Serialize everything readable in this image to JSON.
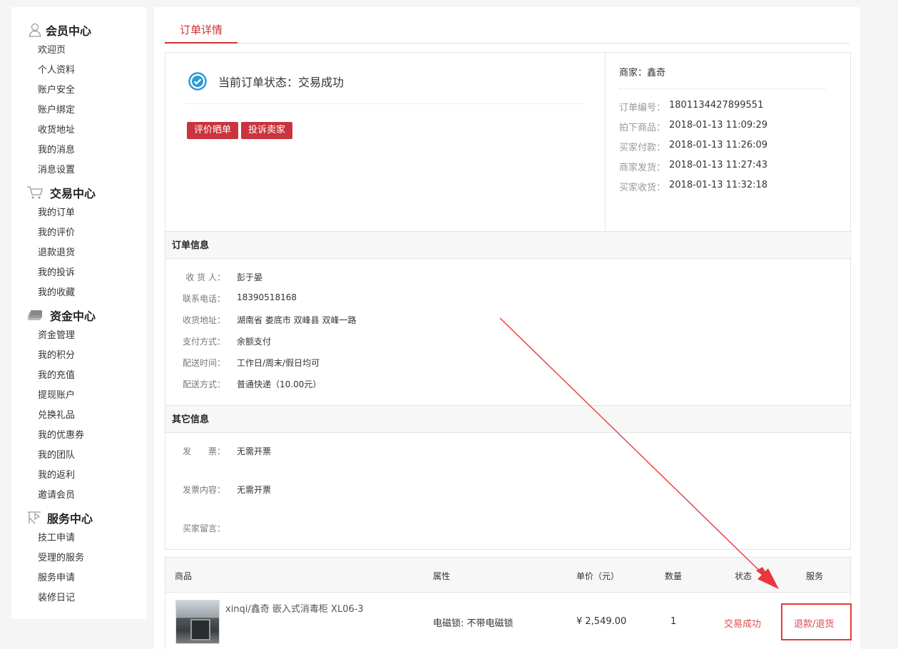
{
  "sidebar": {
    "groups": [
      {
        "title": "会员中心",
        "icon": "user-icon",
        "items": [
          "欢迎页",
          "个人资料",
          "账户安全",
          "账户绑定",
          "收货地址",
          "我的消息",
          "消息设置"
        ]
      },
      {
        "title": "交易中心",
        "icon": "cart-icon",
        "items": [
          "我的订单",
          "我的评价",
          "退款退货",
          "我的投诉",
          "我的收藏"
        ]
      },
      {
        "title": "资金中心",
        "icon": "money-icon",
        "items": [
          "资金管理",
          "我的积分",
          "我的充值",
          "提现账户",
          "兑换礼品",
          "我的优惠券",
          "我的团队",
          "我的返利",
          "邀请会员"
        ]
      },
      {
        "title": "服务中心",
        "icon": "service-icon",
        "items": [
          "技工申请",
          "受理的服务",
          "服务申请",
          "装修日记"
        ]
      }
    ]
  },
  "tab": {
    "label": "订单详情"
  },
  "status": {
    "text": "当前订单状态：交易成功",
    "buttons": [
      "评价晒单",
      "投诉卖家"
    ],
    "merchant": "商家：鑫奇",
    "details": [
      {
        "k": "订单编号：",
        "v": "1801134427899551"
      },
      {
        "k": "拍下商品：",
        "v": "2018-01-13 11:09:29"
      },
      {
        "k": "买家付款：",
        "v": "2018-01-13 11:26:09"
      },
      {
        "k": "商家发货：",
        "v": "2018-01-13 11:27:43"
      },
      {
        "k": "买家收货：",
        "v": "2018-01-13 11:32:18"
      }
    ]
  },
  "order_info": {
    "title": "订单信息",
    "rows": [
      {
        "k": "收 货 人：",
        "v": "彭于晏"
      },
      {
        "k": "联系电话：",
        "v": "18390518168"
      },
      {
        "k": "收货地址：",
        "v": "湖南省 娄底市 双峰县 双峰一路"
      },
      {
        "k": "支付方式：",
        "v": "余额支付"
      },
      {
        "k": "配送时间：",
        "v": "工作日/周末/假日均可"
      },
      {
        "k": "配送方式：",
        "v": "普通快递（10.00元）"
      }
    ]
  },
  "other_info": {
    "title": "其它信息",
    "rows": [
      {
        "k": "发　　票：",
        "v": "无需开票"
      },
      {
        "k": "发票内容：",
        "v": "无需开票"
      },
      {
        "k": "买家留言：",
        "v": ""
      }
    ]
  },
  "goods": {
    "headers": [
      "商品",
      "属性",
      "单价（元）",
      "数量",
      "状态",
      "服务"
    ],
    "item": {
      "name": "xinqi/鑫奇 嵌入式消毒柜 XL06-3",
      "attr": "电磁锁: 不带电磁锁",
      "price": "¥ 2,549.00",
      "qty": "1",
      "status": "交易成功",
      "service": "退款/退货"
    }
  },
  "colors": {
    "accent": "#c9343e",
    "annotation": "#e8383d",
    "check": "#2e9ad8"
  }
}
